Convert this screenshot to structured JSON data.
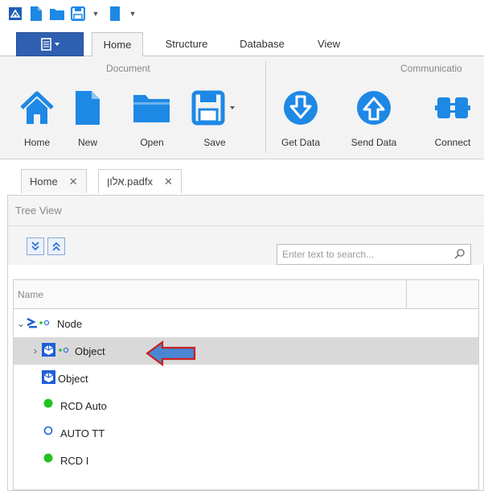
{
  "quick_access": {
    "icons": [
      "app-icon",
      "new-icon",
      "open-icon",
      "save-icon",
      "dropdown-icon",
      "document-icon",
      "dropdown-icon"
    ]
  },
  "ribbon_tabs": {
    "home": "Home",
    "structure": "Structure",
    "database": "Database",
    "view": "View"
  },
  "ribbon": {
    "groups": {
      "document": "Document",
      "communication": "Communicatio"
    },
    "buttons": {
      "home": "Home",
      "new": "New",
      "open": "Open",
      "save": "Save",
      "get_data": "Get Data",
      "send_data": "Send Data",
      "connect": "Connect"
    }
  },
  "doc_tabs": [
    {
      "label": "Home",
      "close": "✕"
    },
    {
      "label": "אלון.padfx",
      "close": "✕"
    }
  ],
  "tree_view": {
    "title": "Tree View",
    "search_placeholder": "Enter text to search...",
    "column_name": "Name",
    "rows": [
      {
        "label": "Node",
        "chevron": "⌄"
      },
      {
        "label": "Object",
        "chevron": "›"
      },
      {
        "label": "Object"
      },
      {
        "label": "RCD Auto"
      },
      {
        "label": "AUTO TT"
      },
      {
        "label": "RCD I"
      }
    ]
  },
  "colors": {
    "accent": "#2f5fb0",
    "icon_blue": "#1e88e5",
    "green_dot": "#22c322",
    "callout_fill": "#4a86d4",
    "callout_stroke": "#cc1f1f"
  }
}
